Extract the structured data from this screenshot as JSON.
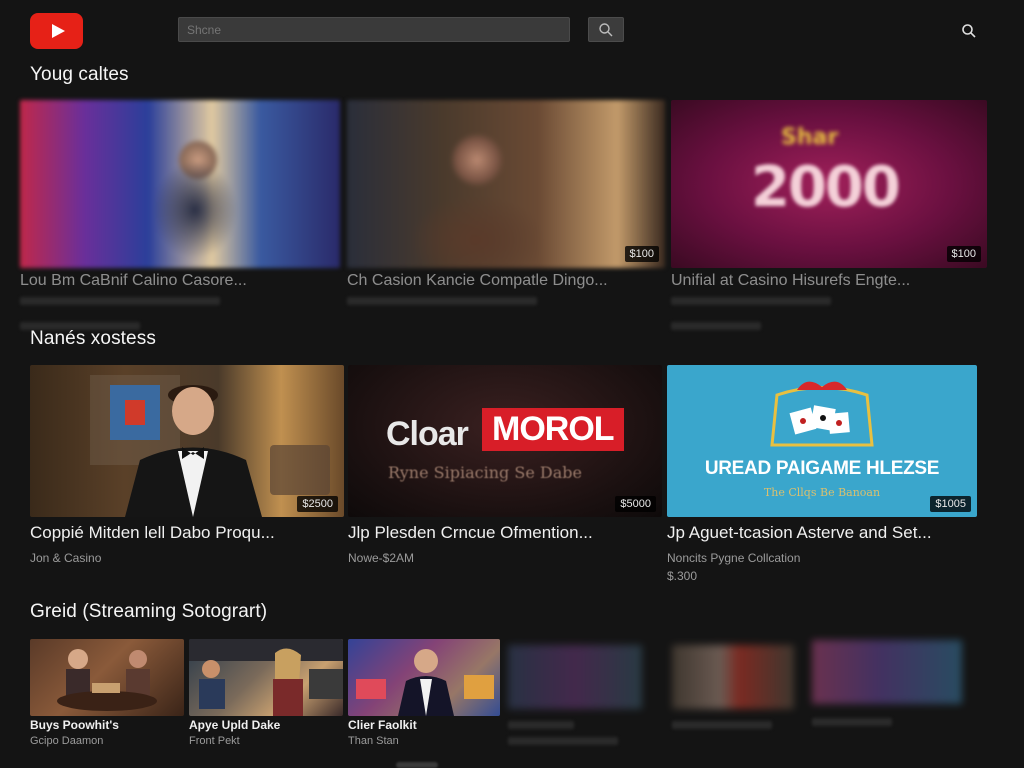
{
  "header": {
    "search_placeholder": "Shcne"
  },
  "sections": [
    {
      "title": "Youg caltes",
      "cards": [
        {
          "title": "Lou Bm CaBnif Calino Casore...",
          "price": ""
        },
        {
          "title": "Ch Casion Kancie Compatle Dingo...",
          "price": "$100",
          "thumb_text": ""
        },
        {
          "title": "Unifial at Casino Hisurefs Engte...",
          "price": "$100",
          "thumb_big": "2000",
          "thumb_small": "Shar"
        }
      ]
    },
    {
      "title": "Nanés xostess",
      "cards": [
        {
          "title": "Coppié Mitden lell Dabo Proqu...",
          "sub": "Jon & Casino",
          "sub2": "",
          "price": "$2500"
        },
        {
          "title": "Jlp Plesden Crncue Ofmention...",
          "sub": "Nowe-$2AM",
          "sub2": "",
          "price": "$5000",
          "thumb_text1": "Cloar",
          "thumb_text2": "MOROL",
          "thumb_text3": "Ryne Sipiacing Se Dabe"
        },
        {
          "title": "Jp Aguet-tcasion Asterve and Set...",
          "sub": "Noncits Pygne Collcation",
          "sub2": "$.300",
          "price": "$1005",
          "thumb_title": "UREAD PAIGAME HLEZSE",
          "thumb_sub": "The Cllqs Be Banoan"
        }
      ]
    },
    {
      "title": "Greid (Streaming Sotogrart)",
      "cards": [
        {
          "title": "Buys Poowhit's",
          "sub": "Gcipo Daamon"
        },
        {
          "title": "Apye Upld Dake",
          "sub": "Front Pekt"
        },
        {
          "title": "Clier Faolkit",
          "sub": "Than Stan"
        },
        {
          "title": "",
          "sub": ""
        },
        {
          "title": "",
          "sub": ""
        },
        {
          "title": "",
          "sub": ""
        }
      ]
    }
  ],
  "colors": {
    "background": "#141414",
    "brand_red": "#e62117",
    "text_primary": "#f1f1f1",
    "text_secondary": "#9b9b9b"
  },
  "icons": [
    "play-logo-icon",
    "search-icon"
  ]
}
